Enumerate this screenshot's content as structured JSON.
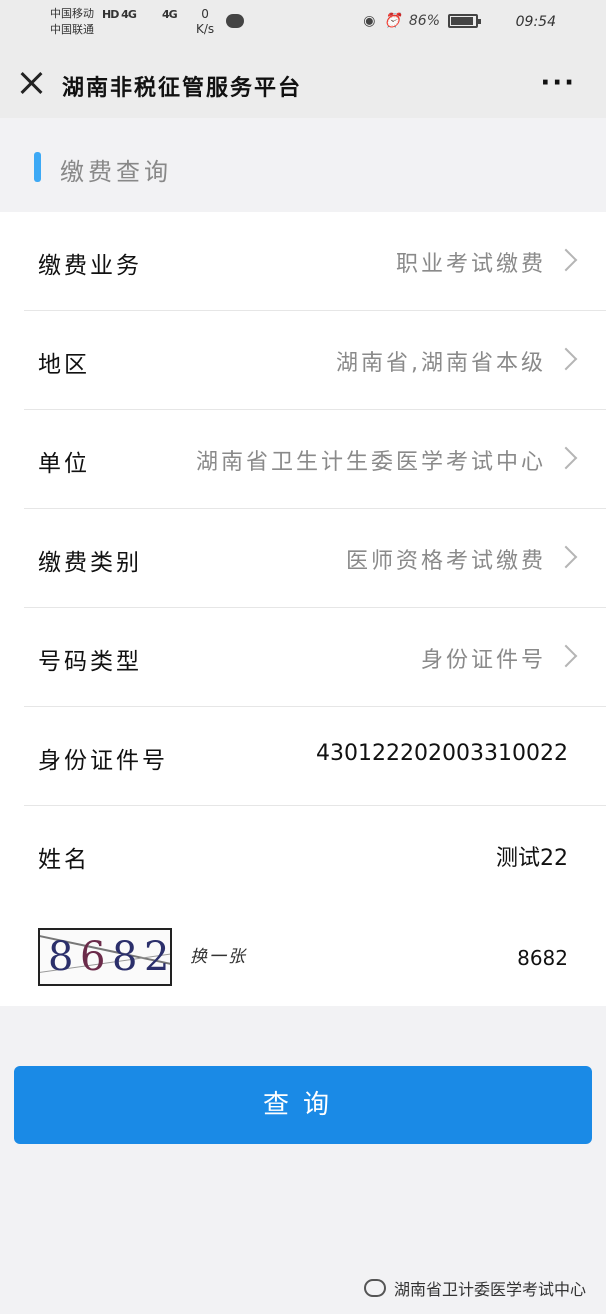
{
  "status_bar": {
    "carrier_1": "中国移动",
    "carrier_2": "中国联通",
    "net_1": "HD 4G",
    "net_2": "4G",
    "speed_value": "0",
    "speed_unit": "K/s",
    "battery": "86%",
    "time": "09:54"
  },
  "nav": {
    "title": "湖南非税征管服务平台",
    "more": "···"
  },
  "section": {
    "title": "缴费查询"
  },
  "form": {
    "rows": [
      {
        "label": "缴费业务",
        "value": "职业考试缴费"
      },
      {
        "label": "地区",
        "value": "湖南省,湖南省本级"
      },
      {
        "label": "单位",
        "value": "湖南省卫生计生委医学考试中心"
      },
      {
        "label": "缴费类别",
        "value": "医师资格考试缴费"
      },
      {
        "label": "号码类型",
        "value": "身份证件号"
      },
      {
        "label": "身份证件号",
        "value": "430122202003310022"
      },
      {
        "label": "姓名",
        "value": "测试22"
      }
    ],
    "captcha": {
      "digits": [
        "8",
        "6",
        "8",
        "2"
      ],
      "refresh_label": "换一张",
      "input_value": "8682"
    }
  },
  "query_button": {
    "label": "查询"
  },
  "watermark": {
    "text": "湖南省卫计委医学考试中心"
  },
  "colors": {
    "accent": "#1a8ae6",
    "section_bar": "#3da9f5"
  }
}
